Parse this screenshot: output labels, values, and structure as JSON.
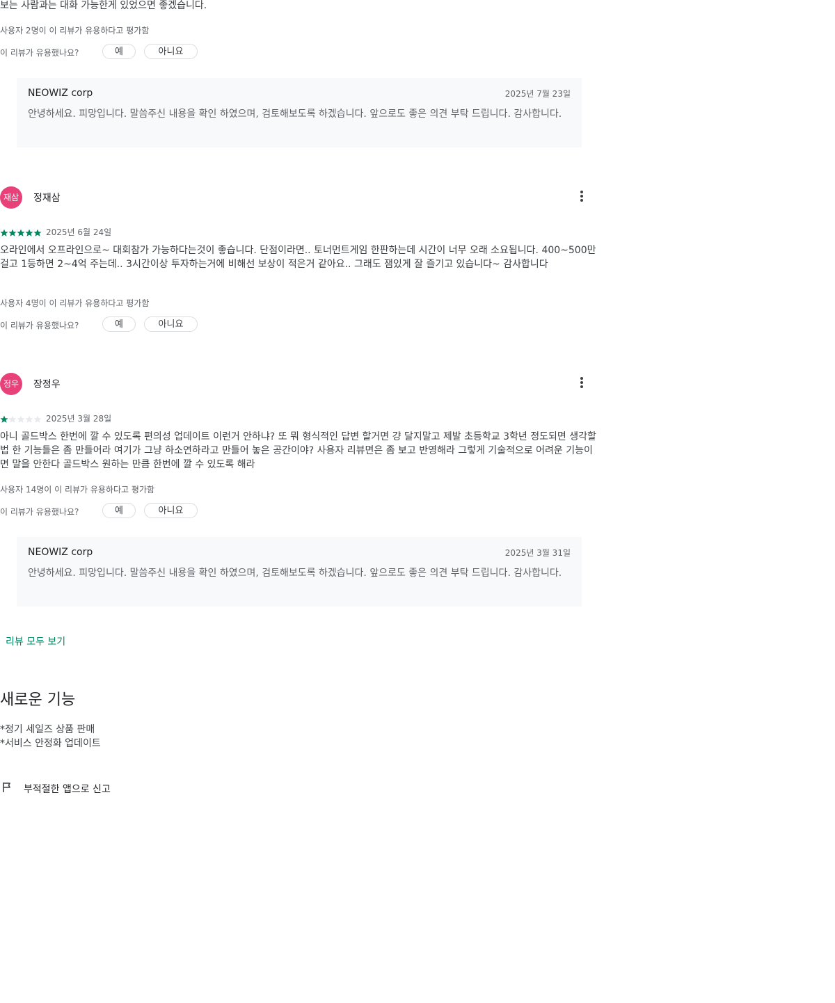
{
  "review_top": {
    "text_tail": "보는 사람과는 대화 가능한게 있었으면 좋겠습니다.",
    "helpful_count": "사용자 2명이 이 리뷰가 유용하다고 평가함",
    "helpful_question": "이 리뷰가 유용했나요?",
    "yes_label": "예",
    "no_label": "아니요",
    "reply": {
      "developer": "NEOWIZ corp",
      "date": "2025년 7월 23일",
      "text": "안녕하세요. 피망입니다. 말씀주신 내용을 확인 하였으며, 검토해보도록 하겠습니다. 앞으로도 좋은 의견 부탁 드립니다. 감사합니다."
    }
  },
  "review_2": {
    "avatar_initials": "재삼",
    "avatar_color": "#e8417a",
    "author": "정재삼",
    "rating": 5,
    "date": "2025년 6월 24일",
    "text": "오라인에서 오프라인으로~ 대회참가 가능하다는것이 좋습니다. 단점이라면.. 토너먼트게임 한판하는데 시간이 너무 오래 소요됩니다. 400~500만 걸고 1등하면 2~4억 주는데.. 3시간이상 투자하는거에 비해선 보상이 적은거 같아요.. 그래도 잼있게 잘 즐기고 있습니다~ 감사합니다",
    "helpful_count": "사용자 4명이 이 리뷰가 유용하다고 평가함",
    "helpful_question": "이 리뷰가 유용했나요?",
    "yes_label": "예",
    "no_label": "아니요"
  },
  "review_3": {
    "avatar_initials": "정우",
    "avatar_color": "#e8417a",
    "author": "장정우",
    "rating": 1,
    "date": "2025년 3월 28일",
    "text": "아니 골드박스 한번에 깔 수 있도록 편의성 업데이트 이런거 안하냐? 또 뭐 형식적인 답변 할거면 걍 달지말고 제발 초등학교 3학년 정도되면 생각할 법 한 기능들은 좀 만들어라 여기가 그냥 하소연하라고 만들어 놓은 공간이야? 사용자 리뷰면은 좀 보고 반영해라 그렇게 기술적으로 어려운 기능이면 말을 안한다 골드박스 원하는 만큼 한번에 깔 수 있도록 해라",
    "helpful_count": "사용자 14명이 이 리뷰가 유용하다고 평가함",
    "helpful_question": "이 리뷰가 유용했나요?",
    "yes_label": "예",
    "no_label": "아니요",
    "reply": {
      "developer": "NEOWIZ corp",
      "date": "2025년 3월 31일",
      "text": "안녕하세요. 피망입니다. 말씀주신 내용을 확인 하였으며, 검토해보도록 하겠습니다. 앞으로도 좋은 의견 부탁 드립니다. 감사합니다."
    }
  },
  "see_all_reviews": "리뷰 모두 보기",
  "whats_new": {
    "title": "새로운 기능",
    "line1": "*정기 세일즈 상품 판매",
    "line2": "*서비스 안정화 업데이트"
  },
  "report": {
    "icon": "flag-icon",
    "label": "부적절한 앱으로 신고"
  },
  "colors": {
    "accent": "#01875f",
    "star_filled": "#01875f",
    "star_empty": "#e8eaed",
    "reply_bg": "#f8f9fa"
  }
}
